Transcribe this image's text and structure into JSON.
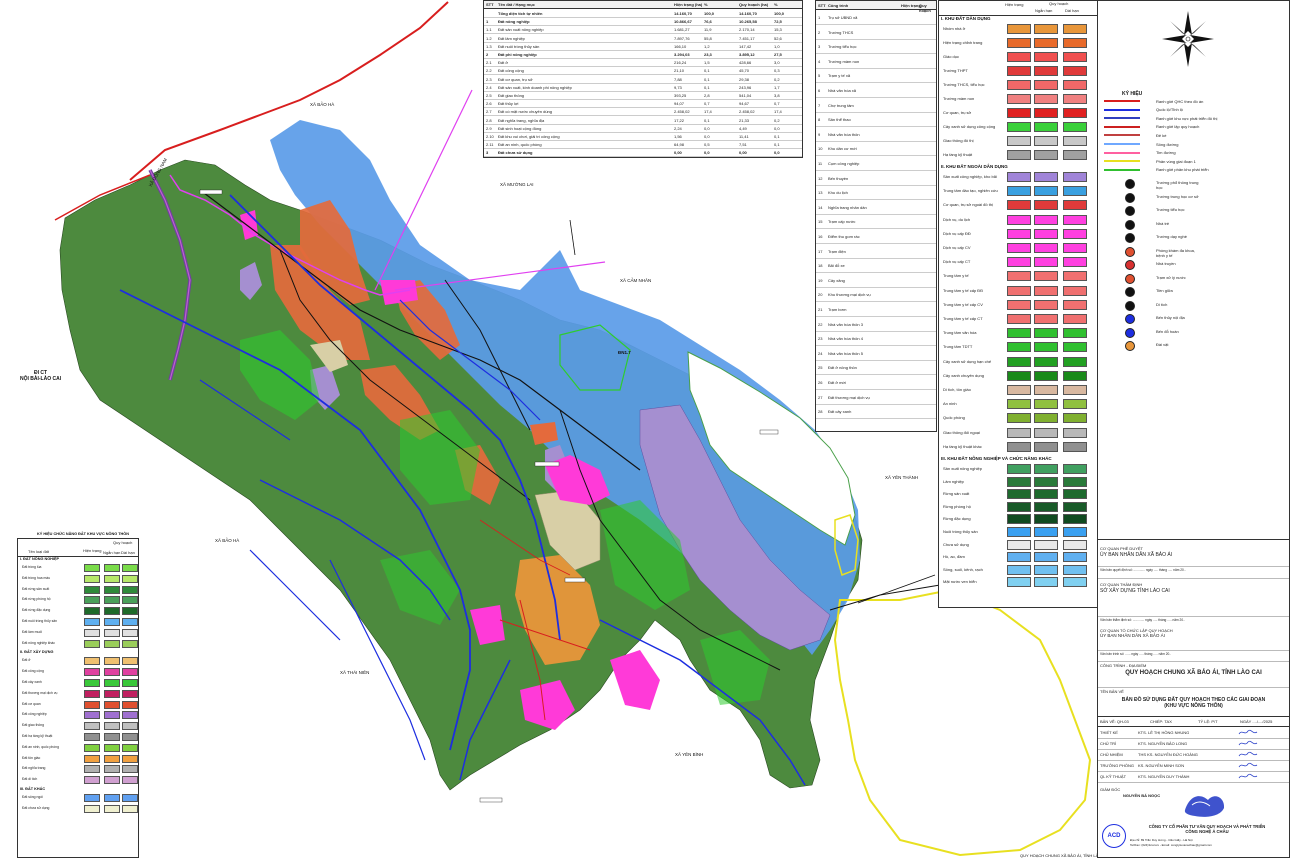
{
  "map": {
    "labels": {
      "highway": "ĐI CT\nNỘI BÀI-LÀO CAI",
      "commune_nw": "XÃ BẢO HÀ",
      "commune_n": "XÃ MƯỜNG LAI",
      "commune_ne": "XÃ CẢM NHÂN",
      "commune_e": "XÃ YÊN THÀNH",
      "commune_s": "XÃ YÊN BÌNH",
      "commune_sw": "XÃ THÁI NIÊN",
      "commune_w": "XÃ BẢO HÀ",
      "river_top": "XÃ ĐỒNG NAM",
      "dn17": "ĐN1.7",
      "bottom_caption": "QUY HOẠCH CHUNG XÃ BẢO ÁI, TỈNH LÀO CAI"
    },
    "colors": {
      "forest": "#4d8a3e",
      "green_bright": "#2ecc2e",
      "water_blue": "#5a9be8",
      "orange_red": "#e46a3c",
      "magenta": "#ff3ad8",
      "purple": "#a58fd0",
      "beige": "#d8cfa6",
      "road_blue": "#1d2ee0",
      "road_black": "#111111",
      "boundary_red": "#d81e1e",
      "boundary_yellow": "#e8e020",
      "boundary_magenta": "#e040f0"
    }
  },
  "data_table": {
    "header": [
      "STT",
      "Tên đất / Hạng mục",
      "Hiện trạng (ha)",
      "%",
      "Quy hoạch (ha)",
      "%"
    ],
    "rows": [
      [
        "",
        "Tổng diện tích tự nhiên",
        "14.160,70",
        "100,0",
        "14.160,70",
        "100,0"
      ],
      [
        "1",
        "Đất nông nghiệp",
        "10.866,67",
        "76,6",
        "10.265,58",
        "72,5"
      ],
      [
        "1.1",
        "Đất sản xuất nông nghiệp",
        "1.681,27",
        "11,9",
        "2.170,14",
        "15,3"
      ],
      [
        "1.2",
        "Đất lâm nghiệp",
        "7.897,76",
        "55,8",
        "7.451,17",
        "52,6"
      ],
      [
        "1.3",
        "Đất nuôi trồng thủy sản",
        "166,10",
        "1,2",
        "147,42",
        "1,0"
      ],
      [
        "2",
        "Đất phi nông nghiệp",
        "3.294,03",
        "23,3",
        "3.895,12",
        "27,5"
      ],
      [
        "2.1",
        "Đất ở",
        "216,24",
        "1,5",
        "428,66",
        "3,0"
      ],
      [
        "2.2",
        "Đất công cộng",
        "21,10",
        "0,1",
        "45,70",
        "0,3"
      ],
      [
        "2.3",
        "Đất cơ quan, trụ sở",
        "7,88",
        "0,1",
        "29,38",
        "0,2"
      ],
      [
        "2.4",
        "Đất sản xuất, kinh doanh phi nông nghiệp",
        "9,73",
        "0,1",
        "243,96",
        "1,7"
      ],
      [
        "2.5",
        "Đất giao thông",
        "393,25",
        "2,8",
        "541,04",
        "3,8"
      ],
      [
        "2.6",
        "Đất thủy lợi",
        "94,07",
        "0,7",
        "94,67",
        "0,7"
      ],
      [
        "2.7",
        "Đất có mặt nước chuyên dùng",
        "2.458,02",
        "17,4",
        "2.458,02",
        "17,4"
      ],
      [
        "2.8",
        "Đất nghĩa trang, nghĩa địa",
        "17,22",
        "0,1",
        "21,33",
        "0,2"
      ],
      [
        "2.9",
        "Đất sinh hoạt cộng đồng",
        "2,24",
        "0,0",
        "4,49",
        "0,0"
      ],
      [
        "2.10",
        "Đất khu vui chơi, giải trí công cộng",
        "1,56",
        "0,0",
        "11,41",
        "0,1"
      ],
      [
        "2.11",
        "Đất an ninh, quốc phòng",
        "64,98",
        "0,5",
        "7,51",
        "0,1"
      ],
      [
        "3",
        "Đất chưa sử dụng",
        "0,00",
        "0,0",
        "0,00",
        "0,0"
      ]
    ]
  },
  "facility_table": {
    "header": [
      "STT",
      "Công trình",
      "Hiện trạng",
      "Quy hoạch"
    ],
    "items": [
      "Trụ sở UBND xã",
      "Trường THCS",
      "Trường tiểu học",
      "Trường mầm non",
      "Trạm y tế xã",
      "Nhà văn hóa xã",
      "Chợ trung tâm",
      "Sân thể thao",
      "Nhà văn hóa thôn",
      "Khu dân cư mới",
      "Cụm công nghiệp",
      "Bến thuyền",
      "Khu du lịch",
      "Nghĩa trang nhân dân",
      "Trạm cấp nước",
      "Điểm thu gom rác",
      "Trạm điện",
      "Bãi đỗ xe",
      "Cây xăng",
      "Khu thương mại dịch vụ",
      "Trạm bơm",
      "Nhà văn hóa thôn 3",
      "Nhà văn hóa thôn 4",
      "Nhà văn hóa thôn 5",
      "Đất ở nông thôn",
      "Đất ở mới",
      "Đất thương mại dịch vụ",
      "Đất cây xanh"
    ]
  },
  "legend_left": {
    "title": "KÝ HIỆU CHỨC NĂNG ĐẤT KHU VỰC NÔNG THÔN",
    "col_current": "Hiện trạng",
    "col_plan": "Quy hoạch",
    "col_short": "Ngắn hạn",
    "col_long": "Dài hạn",
    "col_name": "Tên loại đất",
    "section1": "I. ĐẤT NÔNG NGHIỆP",
    "section2": "II. ĐẤT XÂY DỰNG",
    "section3": "III. ĐẤT KHÁC",
    "items": [
      {
        "label": "Đất trồng lúa",
        "color": "#7adc4a"
      },
      {
        "label": "Đất trồng hoa màu",
        "color": "#b7e86a"
      },
      {
        "label": "Đất rừng sản xuất",
        "color": "#2f8a3a"
      },
      {
        "label": "Đất rừng phòng hộ",
        "color": "#4aa05a"
      },
      {
        "label": "Đất rừng đặc dụng",
        "color": "#1f6a2a"
      },
      {
        "label": "Đất nuôi trồng thủy sản",
        "color": "#5fb0f0"
      },
      {
        "label": "Đất làm muối",
        "color": "#e0e0e0"
      },
      {
        "label": "Đất nông nghiệp khác",
        "color": "#9acd5a"
      },
      {
        "label": "Đất ở",
        "color": "#f0c070"
      },
      {
        "label": "Đất công cộng",
        "color": "#e040a0"
      },
      {
        "label": "Đất cây xanh",
        "color": "#3ac83a"
      },
      {
        "label": "Đất thương mại dịch vụ",
        "color": "#c02060"
      },
      {
        "label": "Đất cơ quan",
        "color": "#e05030"
      },
      {
        "label": "Đất công nghiệp",
        "color": "#a070d0"
      },
      {
        "label": "Đất giao thông",
        "color": "#c0c0c0"
      },
      {
        "label": "Đất hạ tầng kỹ thuật",
        "color": "#909090"
      },
      {
        "label": "Đất an ninh, quốc phòng",
        "color": "#80d040"
      },
      {
        "label": "Đất tôn giáo",
        "color": "#f0a040"
      },
      {
        "label": "Đất nghĩa trang",
        "color": "#b0b0b0"
      },
      {
        "label": "Đất di tích",
        "color": "#d0a0d0"
      },
      {
        "label": "Đất sông ngòi",
        "color": "#60a0f0"
      },
      {
        "label": "Đất chưa sử dụng",
        "color": "#f0f0d0"
      }
    ]
  },
  "legend_center": {
    "col_current": "Hiện trạng",
    "col_plan": "Quy hoạch",
    "col_short": "Ngắn hạn",
    "col_long": "Dài hạn",
    "section1": "I. KHU ĐẤT DÂN DỤNG",
    "section2": "II. KHU ĐẤT NGOÀI DÂN DỤNG",
    "section3": "III. KHU ĐẤT NÔNG NGHIỆP VÀ CHỨC NĂNG KHÁC",
    "items_a": [
      {
        "label": "Nhóm nhà ở",
        "c": "#e8963a"
      },
      {
        "label": "Hiện trạng chỉnh trang",
        "c": "#e86a2a"
      },
      {
        "label": "Giáo dục",
        "c": "#f05050"
      },
      {
        "label": "Trường THPT",
        "c": "#e03a3a"
      },
      {
        "label": "Trường THCS, tiểu học",
        "c": "#f06868"
      },
      {
        "label": "Trường mầm non",
        "c": "#f08080"
      },
      {
        "label": "Cơ quan, trụ sở",
        "c": "#e02020"
      },
      {
        "label": "Cây xanh sử dụng công cộng",
        "c": "#3ad03a"
      },
      {
        "label": "Giao thông đô thị",
        "c": "#c8c8c8"
      },
      {
        "label": "Hạ tầng kỹ thuật",
        "c": "#a0a0a0"
      }
    ],
    "items_b": [
      {
        "label": "Sản xuất công nghiệp, kho bãi",
        "c": "#a084d8"
      },
      {
        "label": "Trung tâm đào tạo, nghiên cứu",
        "c": "#3aa0e0"
      },
      {
        "label": "Cơ quan, trụ sở ngoài đô thị",
        "c": "#e03a3a"
      },
      {
        "label": "Dịch vụ, du lịch",
        "c": "#ff40e0"
      },
      {
        "label": "Dịch vụ cấp ĐĐ",
        "c": "#ff40e0"
      },
      {
        "label": "Dịch vụ cấp CV",
        "c": "#ff40e0"
      },
      {
        "label": "Dịch vụ cấp CT",
        "c": "#ff40e0"
      },
      {
        "label": "Trung tâm y tế",
        "c": "#f07070"
      },
      {
        "label": "Trung tâm y tế cấp ĐĐ",
        "c": "#f07070"
      },
      {
        "label": "Trung tâm y tế cấp CV",
        "c": "#f07070"
      },
      {
        "label": "Trung tâm y tế cấp CT",
        "c": "#f07070"
      },
      {
        "label": "Trung tâm văn hóa",
        "c": "#30c030"
      },
      {
        "label": "Trung tâm TDTT",
        "c": "#30c030"
      },
      {
        "label": "Cây xanh sử dụng hạn chế",
        "c": "#22a022"
      },
      {
        "label": "Cây xanh chuyên dụng",
        "c": "#1a8a1a"
      },
      {
        "label": "Di tích, tôn giáo",
        "c": "#d8b8a0"
      },
      {
        "label": "An ninh",
        "c": "#90c040"
      },
      {
        "label": "Quốc phòng",
        "c": "#80b030"
      },
      {
        "label": "Giao thông đối ngoại",
        "c": "#b8b8b8"
      },
      {
        "label": "Hạ tầng kỹ thuật khác",
        "c": "#909090"
      }
    ],
    "items_c": [
      {
        "label": "Sản xuất nông nghiệp",
        "c": "#40a060"
      },
      {
        "label": "Lâm nghiệp",
        "c": "#2a7a3a"
      },
      {
        "label": "Rừng sản xuất",
        "c": "#1e6a2e"
      },
      {
        "label": "Rừng phòng hộ",
        "c": "#185a28"
      },
      {
        "label": "Rừng đặc dụng",
        "c": "#104a20"
      },
      {
        "label": "Nuôi trồng thủy sản",
        "c": "#3aa0f0"
      },
      {
        "label": "Chưa sử dụng",
        "c": "#e8e8e8"
      },
      {
        "label": "Hồ, ao, đầm",
        "c": "#60b0f0"
      },
      {
        "label": "Sông, suối, kênh, rạch",
        "c": "#70c0f0"
      },
      {
        "label": "Mặt nước ven biển",
        "c": "#80d0f0"
      }
    ]
  },
  "legend_right": {
    "title": "KÝ HIỆU",
    "lines": [
      {
        "label": "Ranh giới QHC theo đồ án",
        "c": "#d81e1e"
      },
      {
        "label": "Quốc lộ/Tỉnh lộ",
        "c": "#1d2ee0"
      },
      {
        "label": "Ranh giới khu vực phát triển đô thị",
        "c": "#3040c0"
      },
      {
        "label": "Ranh giới lập quy hoạch",
        "c": "#cc2020"
      },
      {
        "label": "Đê kè",
        "c": "#c04040"
      },
      {
        "label": "Sông đường",
        "c": "#6fa8ff"
      },
      {
        "label": "Tim đường",
        "c": "#ff60a0"
      },
      {
        "label": "Phân vùng giai đoạn 1",
        "c": "#e8e020"
      },
      {
        "label": "Ranh giới phân khu phát triển",
        "c": "#30c030"
      }
    ],
    "symbols": [
      "Trường phổ thông trung học",
      "Trường trung học cơ sở",
      "Trường tiểu học",
      "Nhà trẻ",
      "Trường dạy nghề",
      "Phòng khám đa khoa, bệnh y tế",
      "Nhà truyền",
      "Trạm xử lý nước",
      "Tiền giữa",
      "Di tích",
      "Bến thủy nội địa",
      "Bến đỗ hoàn",
      "Đài vật"
    ]
  },
  "title_block": {
    "approval_label": "CƠ QUAN PHÊ DUYỆT",
    "approval_org": "ỦY BAN NHÂN DÂN XÃ BẢO ÁI",
    "decision_label": "Văn bản quyết định số: .............  ngày ..... tháng ..... năm 20..",
    "appraisal_label": "CƠ QUAN THẨM ĐỊNH",
    "appraisal_org": "SỞ XÂY DỰNG TỈNH LÀO CAI",
    "appraisal_doc": "Văn bản thẩm định số: .............  ngày ..... tháng ..... năm 20..",
    "organizer_label": "CƠ QUAN TỔ CHỨC LẬP QUY HOẠCH",
    "organizer_org": "ỦY BAN NHÂN DÂN XÃ BẢO ÁI",
    "submission_doc": "Văn bản trình số: ......  ngày ..... tháng ..... năm 20..",
    "project_label": "CÔNG TRÌNH - ĐỊA ĐIỂM",
    "project_name": "QUY HOẠCH CHUNG XÃ BẢO ÁI, TỈNH LÀO CAI",
    "drawing_label": "TÊN BẢN VẼ",
    "drawing_name": "BẢN ĐỒ SỬ DỤNG ĐẤT QUY HOẠCH THEO CÁC GIAI ĐOẠN\n(KHU VỰC NÔNG THÔN)",
    "drawing_no_label": "BẢN VẼ: QH-03",
    "scale_label": "CHIẾP: TAX",
    "ratio_label": "TỶ LỆ: P/T",
    "date_label": "NGÀY ..../..../2025",
    "staff": [
      {
        "role": "THIẾT KẾ",
        "name": "KTS. LÊ THỊ HỒNG NHUNG"
      },
      {
        "role": "CHỦ TRÌ",
        "name": "KTS. NGUYỄN BẢO LONG"
      },
      {
        "role": "CHỦ NHIỆM",
        "name": "THS KS. NGUYỄN ĐỨC HOÀNG"
      },
      {
        "role": "TRƯỞNG PHÒNG",
        "name": "KS. NGUYỄN MINH SƠN"
      },
      {
        "role": "QL KỸ THUẬT",
        "name": "KTS. NGUYỄN DUY THÀNH"
      }
    ],
    "director_label": "GIÁM ĐỐC",
    "director_name": "NGUYỄN BÁ NGỌC",
    "company_name": "CÔNG TY CỔ PHẦN TƯ VẤN QUY HOẠCH VÀ PHÁT TRIỂN\nCÔNG NGHỆ Á CHÂU",
    "company_addr": "Địa chỉ: 89 Trần Duy Hưng - Cầu Giấy - Hà Nội",
    "company_contact": "Tel/Fax: (024)3xxxxxx - Email: congtytuvanachau@gmail.com",
    "logo_text": "ACD"
  }
}
